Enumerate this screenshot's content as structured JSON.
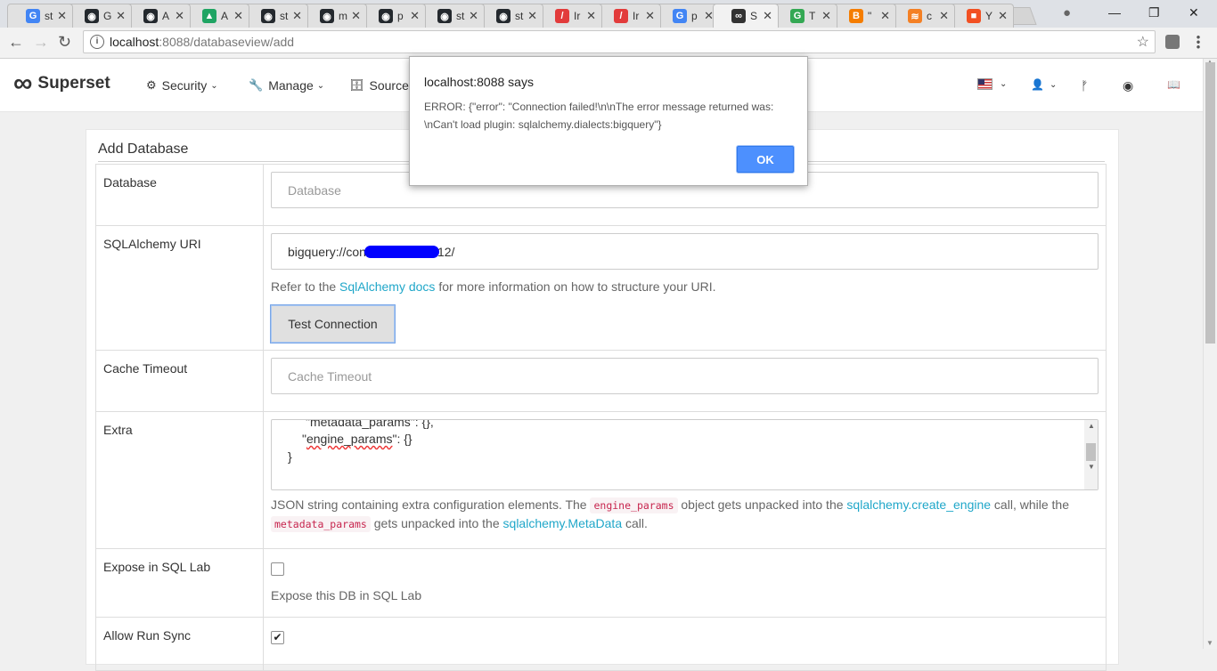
{
  "browser": {
    "tabs": [
      {
        "letter": "G",
        "title": "st",
        "color": "#4285f4"
      },
      {
        "letter": "◉",
        "title": "G",
        "color": "#24292e"
      },
      {
        "letter": "◉",
        "title": "A",
        "color": "#24292e"
      },
      {
        "letter": "▲",
        "title": "A",
        "color": "#1fa463"
      },
      {
        "letter": "◉",
        "title": "st",
        "color": "#24292e"
      },
      {
        "letter": "◉",
        "title": "m",
        "color": "#24292e"
      },
      {
        "letter": "◉",
        "title": "p",
        "color": "#24292e"
      },
      {
        "letter": "◉",
        "title": "st",
        "color": "#24292e"
      },
      {
        "letter": "◉",
        "title": "st",
        "color": "#24292e"
      },
      {
        "letter": "/",
        "title": "Ir",
        "color": "#e23b3b"
      },
      {
        "letter": "/",
        "title": "Ir",
        "color": "#e23b3b"
      },
      {
        "letter": "G",
        "title": "p",
        "color": "#4285f4"
      },
      {
        "letter": "∞",
        "title": "S",
        "color": "#333333"
      },
      {
        "letter": "G",
        "title": "T",
        "color": "#34a853"
      },
      {
        "letter": "B",
        "title": "\"",
        "color": "#f57d00"
      },
      {
        "letter": "≋",
        "title": "c",
        "color": "#f48024"
      },
      {
        "letter": "■",
        "title": "Y",
        "color": "#f25022"
      }
    ],
    "close_glyph": "✕",
    "active_tab_index": 12,
    "window_controls": {
      "minimize": "—",
      "restore": "❐",
      "close": "✕",
      "profile": "●"
    },
    "nav": {
      "back": "←",
      "forward": "→",
      "reload": "↻"
    },
    "url_host": "localhost",
    "url_path": ":8088/databaseview/add",
    "star": "☆"
  },
  "navbar": {
    "brand_logo": "∞",
    "brand_name": "Superset",
    "menus": [
      {
        "icon": "⚙",
        "label": "Security"
      },
      {
        "icon": "🔧",
        "label": "Manage"
      },
      {
        "icon": "🗄",
        "label": "Sources"
      }
    ],
    "caret": "⌄",
    "right_icons": {
      "user": "👤",
      "branch": "ᚠ",
      "github": "◉",
      "book": "📖"
    }
  },
  "form": {
    "title": "Add Database",
    "database": {
      "label": "Database",
      "placeholder": "Database"
    },
    "sqlalchemy_uri": {
      "label": "SQLAlchemy URI",
      "value_prefix": "bigquery://con",
      "value_suffix": "12/",
      "help_before": "Refer to the ",
      "help_link": "SqlAlchemy docs",
      "help_after": " for more information on how to structure your URI.",
      "test_button": "Test Connection"
    },
    "cache_timeout": {
      "label": "Cache Timeout",
      "placeholder": "Cache Timeout"
    },
    "extra": {
      "label": "Extra",
      "line1": "\"metadata_params\": {},",
      "line2_prefix": "\"",
      "line2_key": "engine_params",
      "line2_suffix": "\": {}",
      "line3": "}",
      "help_1": "JSON string containing extra configuration elements. The ",
      "code_1": "engine_params",
      "help_2": " object gets unpacked into the ",
      "link_1": "sqlalchemy.create_engine",
      "help_3": " call, while the ",
      "code_2": "metadata_params",
      "help_4": " gets unpacked into the ",
      "link_2": "sqlalchemy.MetaData",
      "help_5": " call."
    },
    "expose_sql_lab": {
      "label": "Expose in SQL Lab",
      "checked": false,
      "help": "Expose this DB in SQL Lab"
    },
    "allow_run_sync": {
      "label": "Allow Run Sync",
      "checked": true,
      "check_glyph": "✔"
    }
  },
  "dialog": {
    "title": "localhost:8088 says",
    "message_line1": "ERROR: {\"error\": \"Connection failed!\\n\\nThe error message returned was:",
    "message_line2": "\\nCan't load plugin: sqlalchemy.dialects:bigquery\"}",
    "ok_label": "OK"
  },
  "colors": {
    "link": "#20a7c9",
    "ok_button": "#4d90fe",
    "redaction": "#0000ff"
  }
}
